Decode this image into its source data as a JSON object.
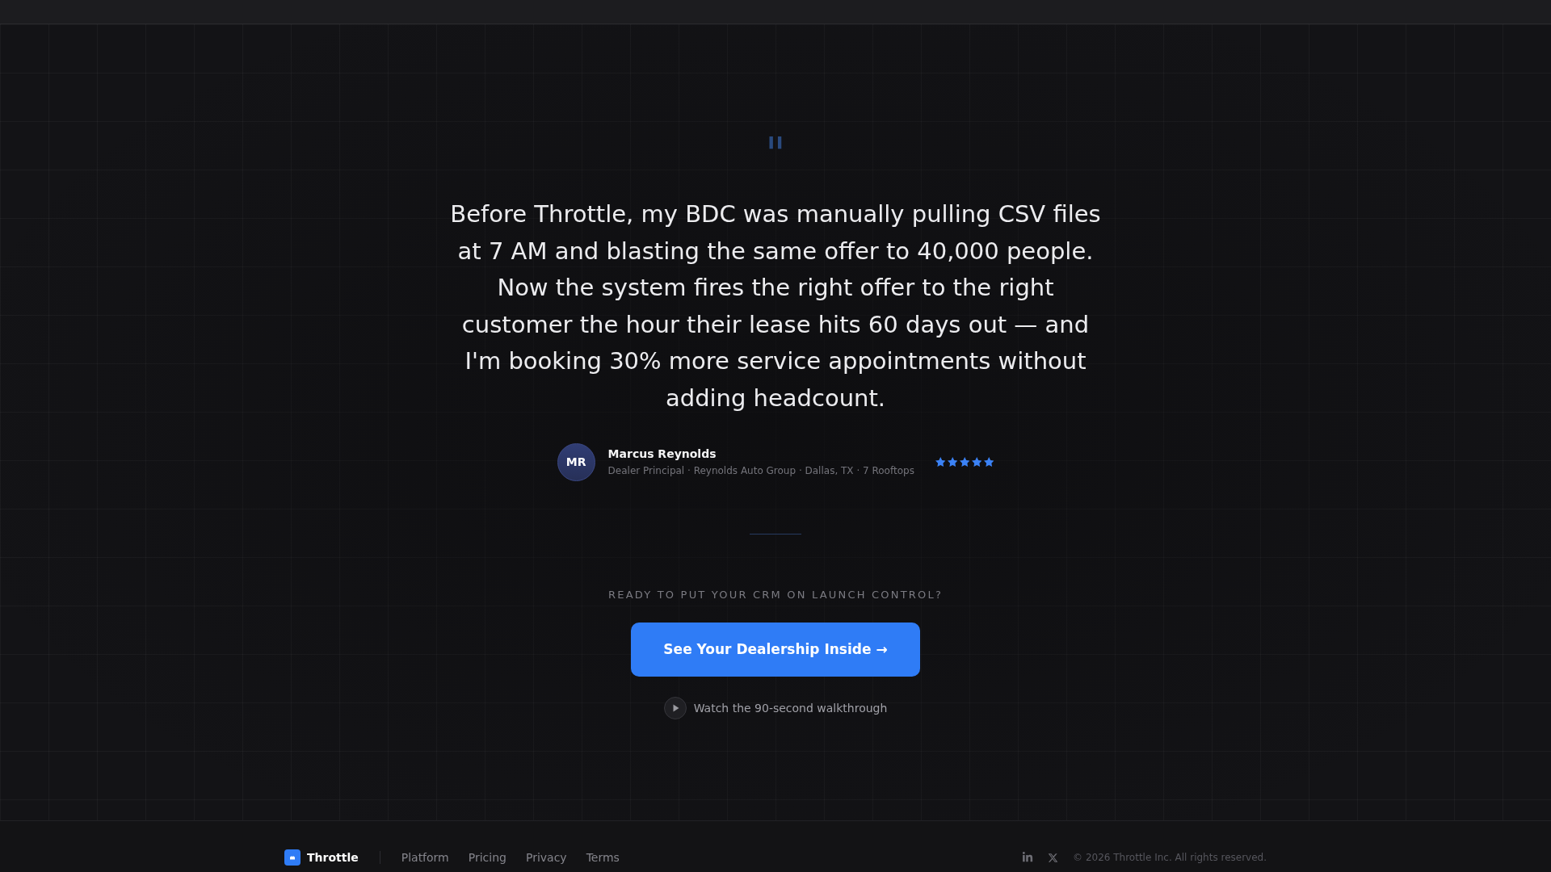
{
  "testimonial": {
    "quote_mark": "\"",
    "quote": "Before Throttle, my BDC was manually pulling CSV files at 7 AM and blasting the same offer to 40,000 people. Now the system fires the right offer to the right customer the hour their lease hits 60 days out — and I'm booking 30% more service appointments without adding headcount.",
    "author": {
      "initials": "MR",
      "name": "Marcus Reynolds",
      "details": "Dealer Principal · Reynolds Auto Group · Dallas, TX · 7 Rooftops",
      "stars": 5
    }
  },
  "cta": {
    "eyebrow": "READY TO PUT YOUR CRM ON LAUNCH CONTROL?",
    "button": "See Your Dealership Inside →",
    "video_link": "Watch the 90-second walkthrough"
  },
  "footer": {
    "brand": "Throttle",
    "links": [
      "Platform",
      "Pricing",
      "Privacy",
      "Terms"
    ],
    "copyright": "© 2026 Throttle Inc. All rights reserved."
  }
}
